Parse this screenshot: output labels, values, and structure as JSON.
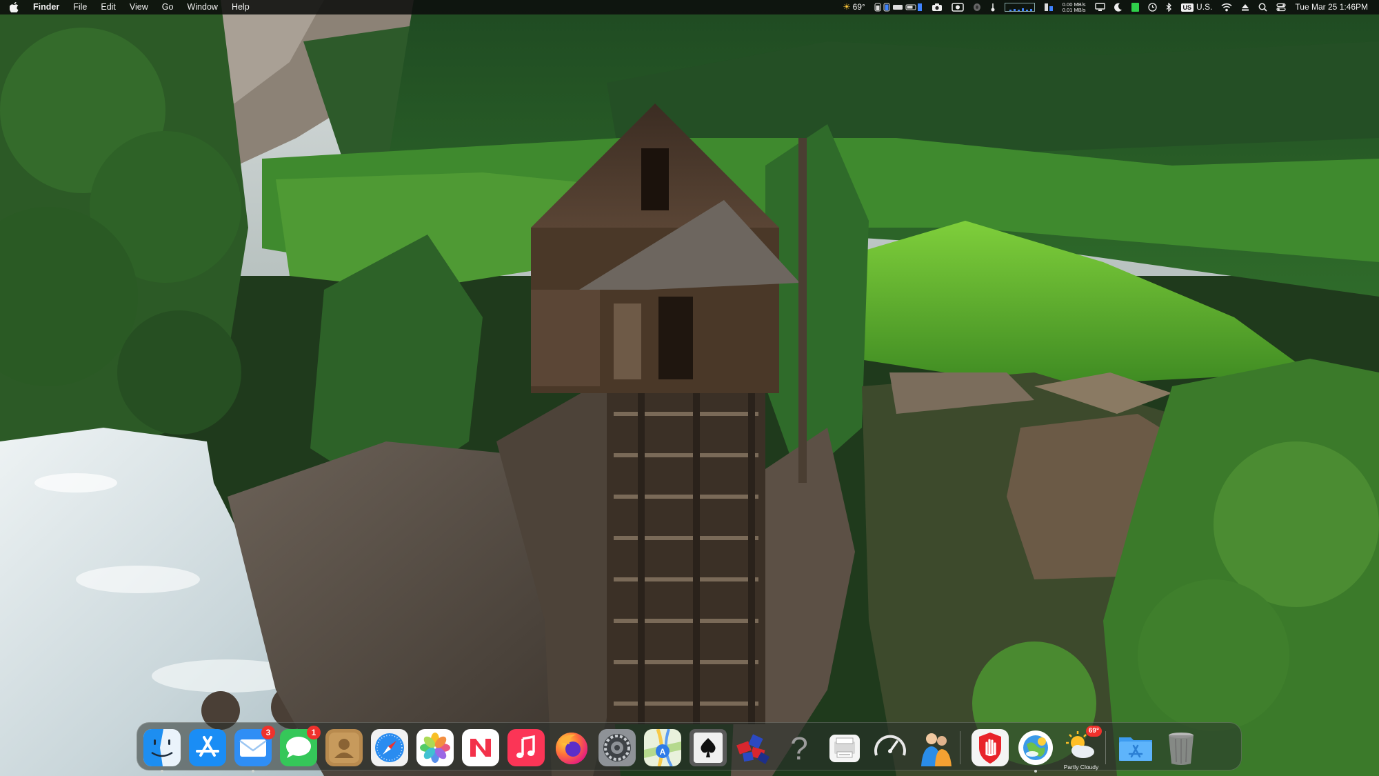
{
  "menubar": {
    "active_app": "Finder",
    "menus": [
      "File",
      "Edit",
      "View",
      "Go",
      "Window",
      "Help"
    ],
    "weather_temp": "69°",
    "net_up": "0.00 MB/s",
    "net_down": "0.01 MB/s",
    "input_source_badge": "US",
    "input_source_label": "U.S.",
    "clock": "Tue Mar 25  1:46PM"
  },
  "dock": {
    "apps": [
      {
        "name": "Finder",
        "icon": "finder-icon",
        "running": true
      },
      {
        "name": "App Store",
        "icon": "app-store-icon"
      },
      {
        "name": "Mail",
        "icon": "mail-icon",
        "badge": "3",
        "running": true
      },
      {
        "name": "Messages",
        "icon": "messages-icon",
        "badge": "1"
      },
      {
        "name": "Contacts",
        "icon": "contacts-icon"
      },
      {
        "name": "Safari",
        "icon": "safari-icon"
      },
      {
        "name": "Photos",
        "icon": "photos-icon"
      },
      {
        "name": "News",
        "icon": "news-icon"
      },
      {
        "name": "Music",
        "icon": "music-icon"
      },
      {
        "name": "Firefox",
        "icon": "firefox-icon"
      },
      {
        "name": "System Settings",
        "icon": "system-settings-icon"
      },
      {
        "name": "Maps",
        "icon": "maps-icon"
      },
      {
        "name": "Solitaire",
        "icon": "spade-card-icon"
      },
      {
        "name": "Puzzle Game",
        "icon": "puzzle-game-icon"
      },
      {
        "name": "Help",
        "icon": "question-mark-icon"
      },
      {
        "name": "Printer",
        "icon": "printer-icon"
      },
      {
        "name": "Activity Monitor",
        "icon": "speedometer-icon"
      },
      {
        "name": "People App",
        "icon": "people-icon"
      },
      {
        "name": "Stop Hand App",
        "icon": "stop-hand-icon"
      },
      {
        "name": "Weather Widget",
        "icon": "weather-globe-icon",
        "running": true
      },
      {
        "name": "Weather",
        "icon": "weather-sun-cloud-icon",
        "badge": "69°",
        "caption": "Partly Cloudy"
      },
      {
        "name": "Applications Folder",
        "icon": "applications-folder-icon"
      },
      {
        "name": "Trash",
        "icon": "trash-icon"
      }
    ]
  }
}
